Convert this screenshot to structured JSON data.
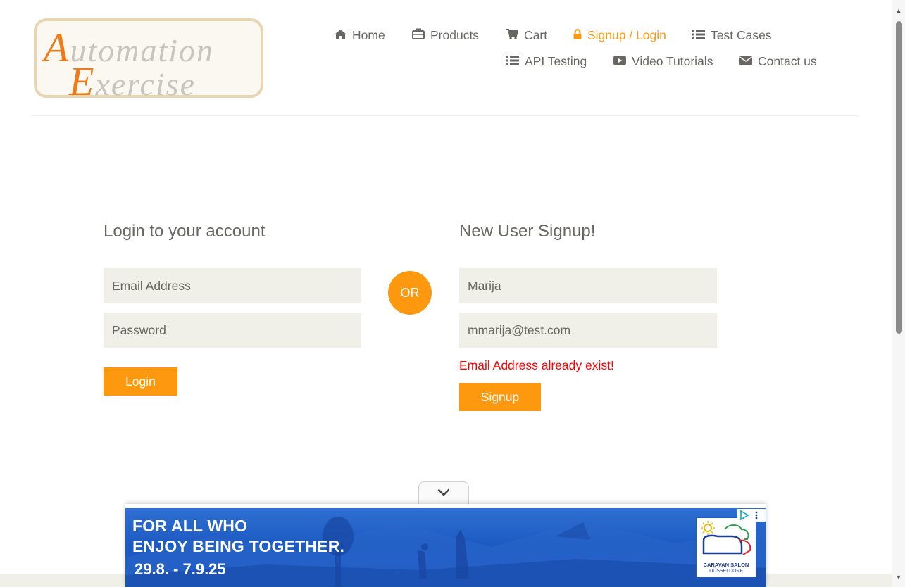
{
  "logo": {
    "line1_cap": "A",
    "line1_rest": "utomation",
    "line2_cap": "E",
    "line2_rest": "xercise"
  },
  "nav": [
    {
      "label": "Home",
      "icon": "home-icon"
    },
    {
      "label": "Products",
      "icon": "briefcase-icon"
    },
    {
      "label": "Cart",
      "icon": "cart-icon"
    },
    {
      "label": "Signup / Login",
      "icon": "lock-icon",
      "active": true
    },
    {
      "label": "Test Cases",
      "icon": "list-icon"
    },
    {
      "label": "API Testing",
      "icon": "list-icon"
    },
    {
      "label": "Video Tutorials",
      "icon": "youtube-play-icon"
    },
    {
      "label": "Contact us",
      "icon": "envelope-icon"
    }
  ],
  "login": {
    "title": "Login to your account",
    "email_placeholder": "Email Address",
    "password_placeholder": "Password",
    "button": "Login"
  },
  "or_label": "OR",
  "signup": {
    "title": "New User Signup!",
    "name_value": "Marija",
    "email_value": "mmarija@test.com",
    "error": "Email Address already exist!",
    "button": "Signup"
  },
  "ad": {
    "line1": "FOR ALL WHO",
    "line2": "ENJOY BEING TOGETHER.",
    "dates": "29.8. - 7.9.25",
    "logo_line1": "CARAVAN SALON",
    "logo_line2": "DÜSSELDORF"
  },
  "colors": {
    "accent": "#fe980f",
    "text": "#696763",
    "input_bg": "#f0f0e9",
    "error": "#ff0000",
    "ad_blue": "#1d5bc4"
  }
}
